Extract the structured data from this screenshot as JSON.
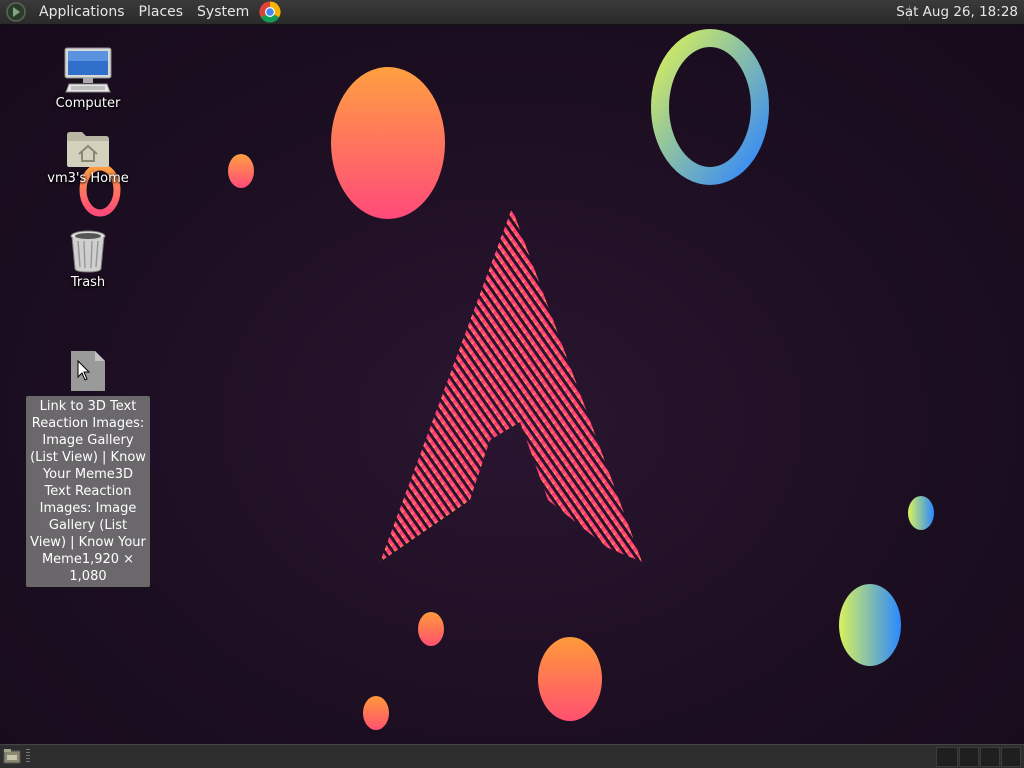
{
  "top_panel": {
    "menus": [
      "Applications",
      "Places",
      "System"
    ],
    "launcher_icon": "chrome-browser-icon",
    "clock": "Sat Aug 26, 18:28"
  },
  "desktop": {
    "icons": [
      {
        "label": "Computer",
        "icon": "computer-icon"
      },
      {
        "label": "vm3's Home",
        "icon": "home-folder-icon"
      },
      {
        "label": "Trash",
        "icon": "trash-icon"
      }
    ],
    "selected_file": {
      "icon": "file-icon",
      "label": "Link to 3D Text Reaction Images: Image Gallery (List View) | Know Your Meme3D Text Reaction Images: Image Gallery (List View) | Know Your Meme1,920 × 1,080"
    }
  },
  "wallpaper": {
    "colors": {
      "orange": "#ff9a3c",
      "pink": "#ff3c7a",
      "green": "#c8f05a",
      "blue": "#2f8cff",
      "background": "#1d0f22"
    }
  }
}
